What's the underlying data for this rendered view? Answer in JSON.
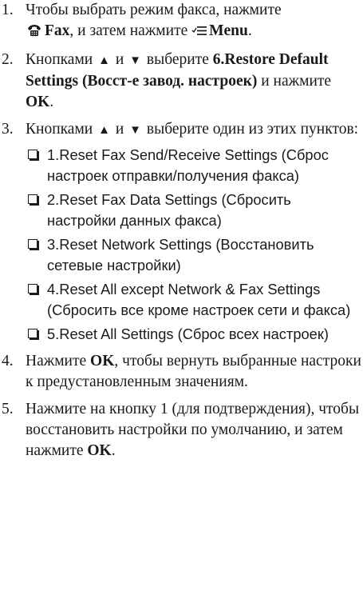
{
  "steps": [
    {
      "num": "1.",
      "t1": "Чтобы выбрать режим факса, нажмите",
      "fax_label": "Fax",
      "t2": ", и затем нажмите",
      "menu_label": "Menu",
      "t3": "."
    },
    {
      "num": "2.",
      "t1": "Кнопками",
      "t2": "и",
      "t3": "выберите",
      "setting": "6.Restore Default Settings (Восст-е завод. настроек)",
      "t4": "и нажмите",
      "ok": "OK",
      "t5": "."
    },
    {
      "num": "3.",
      "t1": "Кнопками",
      "t2": "и",
      "t3": "выберите один из этих пунктов:",
      "options": [
        "1.Reset Fax Send/Receive Settings (Сброс настроек отправки/получения факса)",
        "2.Reset Fax Data Settings (Сбросить настройки данных факса)",
        "3.Reset Network Settings (Восстановить сетевые настройки)",
        "4.Reset All except Network & Fax Settings (Сбросить все кроме настроек сети и факса)",
        "5.Reset All Settings (Сброс всех настроек)"
      ]
    },
    {
      "num": "4.",
      "t1": "Нажмите",
      "ok": "OK",
      "t2": ", чтобы вернуть выбранные настроки к предустановленным значениям."
    },
    {
      "num": "5.",
      "t1": "Нажмите на кнопку 1 (для подтверждения), чтобы восстановить настройки по умолчанию, и затем нажмите",
      "ok": "OK",
      "t2": "."
    }
  ],
  "glyphs": {
    "up": "▲",
    "down": "▼"
  },
  "icons": {
    "fax": "fax-icon",
    "menu": "menu-icon",
    "checkbox": "checkbox-icon"
  }
}
